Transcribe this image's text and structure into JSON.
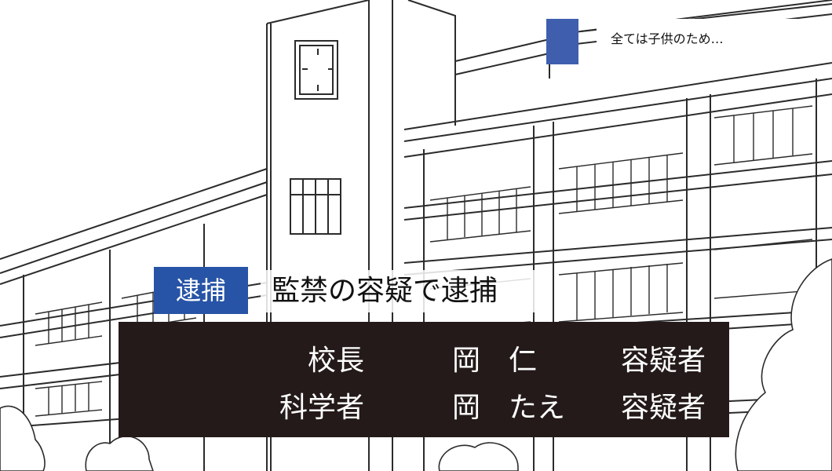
{
  "caption": {
    "text": "全ては子供のため…",
    "tag_color": "#3f5fae"
  },
  "headline": {
    "badge": "逮捕",
    "badge_color": "#2754a6",
    "text": "監禁の容疑で逮捕"
  },
  "people": [
    {
      "title": "校長",
      "name": "岡　仁",
      "status": "容疑者"
    },
    {
      "title": "科学者",
      "name": "岡　たえ",
      "status": "容疑者"
    }
  ],
  "background": {
    "description_icon": "school-building-illustration"
  }
}
